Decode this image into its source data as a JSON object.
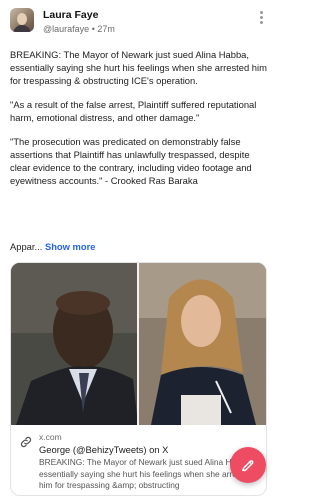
{
  "author": {
    "name": "Laura Faye",
    "handle": "@laurafaye",
    "separator": "•",
    "time": "27m"
  },
  "post": {
    "paragraphs": [
      "BREAKING: The Mayor of Newark just sued Alina Habba, essentially saying she hurt his feelings when she arrested him for trespassing & obstructing ICE's operation.",
      "\"As a result of the false arrest, Plaintiff suffered reputational harm, emotional distress, and other damage.\"",
      "\"The prosecution was predicated on demonstrably false assertions that Plaintiff has unlawfully trespassed, despite clear evidence to the contrary, including video footage and eyewitness accounts.\" - Crooked Ras Baraka"
    ],
    "truncated_text": "Appar...",
    "show_more_label": "Show more"
  },
  "link_card": {
    "domain": "x.com",
    "title": "George (@BehizyTweets) on X",
    "description": "BREAKING: The Mayor of Newark just sued Alina Habba, essentially saying she hurt his feelings when she arrested him for trespassing &amp; obstructing"
  },
  "icons": {
    "more": "more-vertical-icon",
    "link": "link-icon",
    "compose": "edit-icon"
  },
  "colors": {
    "accent_link": "#2563eb",
    "fab": "#ee4c63"
  }
}
